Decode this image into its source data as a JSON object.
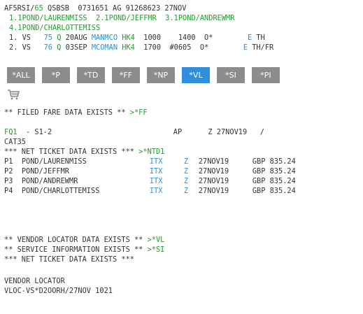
{
  "header": {
    "pnr_prefix": "AF5RSI/",
    "pnr_num": "65",
    "pnr_rest": " QSBSB  0731651 AG 91268623 27NOV"
  },
  "passengers_line1": [
    {
      "n": "1.1",
      "name": "POND/LAURENMISS"
    },
    {
      "n": "2.1",
      "name": "POND/JEFFMR"
    },
    {
      "n": "3.1",
      "name": "POND/ANDREWMR"
    }
  ],
  "passengers_line2": [
    {
      "n": "4.1",
      "name": "POND/CHARLOTTEMISS"
    }
  ],
  "segments": [
    {
      "num": "1. VS   ",
      "flight": "75",
      "class": "Q",
      "date": " 20AUG ",
      "city": "MANMCO",
      "status": "HK4",
      "dep": "  1000    1400  O*        ",
      "e": "E",
      "days": " TH"
    },
    {
      "num": "2. VS   ",
      "flight": "76",
      "class": "Q",
      "date": " 03SEP ",
      "city": "MCOMAN",
      "status": "HK4",
      "dep": "  1700  #0605  O*        ",
      "e": "E",
      "days": " TH/FR"
    }
  ],
  "buttons": [
    {
      "label": "*ALL",
      "active": false
    },
    {
      "label": "*P",
      "active": false
    },
    {
      "label": "*TD",
      "active": false
    },
    {
      "label": "*FF",
      "active": false
    },
    {
      "label": "*NP",
      "active": false
    },
    {
      "label": "*VL",
      "active": true
    },
    {
      "label": "*SI",
      "active": false
    },
    {
      "label": "*PI",
      "active": false
    }
  ],
  "filed_fare": {
    "text": "** FILED FARE DATA EXISTS ** ",
    "link": ">*FF"
  },
  "fq": {
    "code": "FQ1",
    "rest": "  - S1-2                            AP      Z 27NOV19   /"
  },
  "cat": "CAT35",
  "net_ticket": {
    "text": "*** NET TICKET DATA EXISTS *** ",
    "link": ">*NTD1"
  },
  "fare_rows": [
    {
      "p": "P1",
      "name": "POND/LAURENMISS",
      "itx": "ITX",
      "z": "Z",
      "date": "27NOV19",
      "amt": "GBP 835.24"
    },
    {
      "p": "P2",
      "name": "POND/JEFFMR",
      "itx": "ITX",
      "z": "Z",
      "date": "27NOV19",
      "amt": "GBP 835.24"
    },
    {
      "p": "P3",
      "name": "POND/ANDREWMR",
      "itx": "ITX",
      "z": "Z",
      "date": "27NOV19",
      "amt": "GBP 835.24"
    },
    {
      "p": "P4",
      "name": "POND/CHARLOTTEMISS",
      "itx": "ITX",
      "z": "Z",
      "date": "27NOV19",
      "amt": "GBP 835.24"
    }
  ],
  "vendor_locator_exists": {
    "text": "** VENDOR LOCATOR DATA EXISTS ** ",
    "link": ">*VL"
  },
  "service_info_exists": {
    "text": "** SERVICE INFORMATION EXISTS ** ",
    "link": ">*SI"
  },
  "net_ticket2": "*** NET TICKET DATA EXISTS ***",
  "vendor_locator_title": "VENDOR LOCATOR",
  "vendor_locator_value": "VLOC-VS*D2OORH/27NOV 1021",
  "colors": {
    "green": "#1e9e2a",
    "blue": "#2e8fd6",
    "button": "#8c8c8c",
    "button_active": "#2f8fdc"
  },
  "icons": {
    "cart": "shopping-cart-icon"
  }
}
